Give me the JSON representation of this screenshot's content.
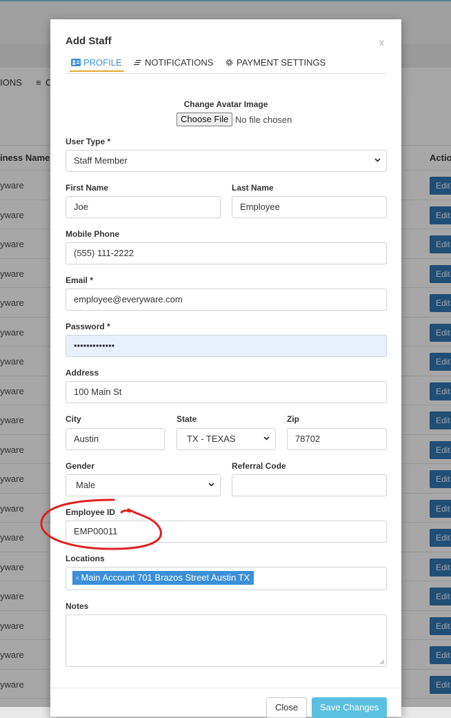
{
  "background": {
    "tabs": [
      "IONS",
      "C"
    ],
    "table": {
      "business_header": "iness Name",
      "action_header": "Actio",
      "row_business": "yware",
      "edit_label": "Edit",
      "row_count": 18
    }
  },
  "modal": {
    "title": "Add Staff",
    "close": "x",
    "tabs": [
      {
        "label": "PROFILE",
        "icon": "id-card-icon",
        "active": true
      },
      {
        "label": "NOTIFICATIONS",
        "icon": "lines-icon",
        "active": false
      },
      {
        "label": "PAYMENT SETTINGS",
        "icon": "gear-icon",
        "active": false
      }
    ],
    "avatar": {
      "label": "Change Avatar Image",
      "button": "Choose File",
      "status": "No file chosen"
    },
    "user_type": {
      "label": "User Type *",
      "value": "Staff Member"
    },
    "first_name": {
      "label": "First Name",
      "value": "Joe"
    },
    "last_name": {
      "label": "Last Name",
      "value": "Employee"
    },
    "mobile": {
      "label": "Mobile Phone",
      "value": "(555) 111-2222"
    },
    "email": {
      "label": "Email *",
      "value": "employee@everyware.com"
    },
    "password": {
      "label": "Password *",
      "value": "•••••••••••••"
    },
    "address": {
      "label": "Address",
      "value": "100 Main St"
    },
    "city": {
      "label": "City",
      "value": "Austin"
    },
    "state": {
      "label": "State",
      "value": "TX - TEXAS"
    },
    "zip": {
      "label": "Zip",
      "value": "78702"
    },
    "gender": {
      "label": "Gender",
      "value": "Male"
    },
    "referral": {
      "label": "Referral Code",
      "value": ""
    },
    "employee_id": {
      "label": "Employee ID",
      "value": "EMP00011"
    },
    "locations": {
      "label": "Locations",
      "tag_remove": "×",
      "tag": "Main Account 701 Brazos Street Austin TX"
    },
    "notes": {
      "label": "Notes",
      "value": ""
    },
    "buttons": {
      "close": "Close",
      "save": "Save Changes"
    }
  },
  "colors": {
    "accent": "#3b8fd6",
    "tab_underline": "#e5a72b",
    "annotation": "#e02020",
    "save": "#5bc0de"
  }
}
